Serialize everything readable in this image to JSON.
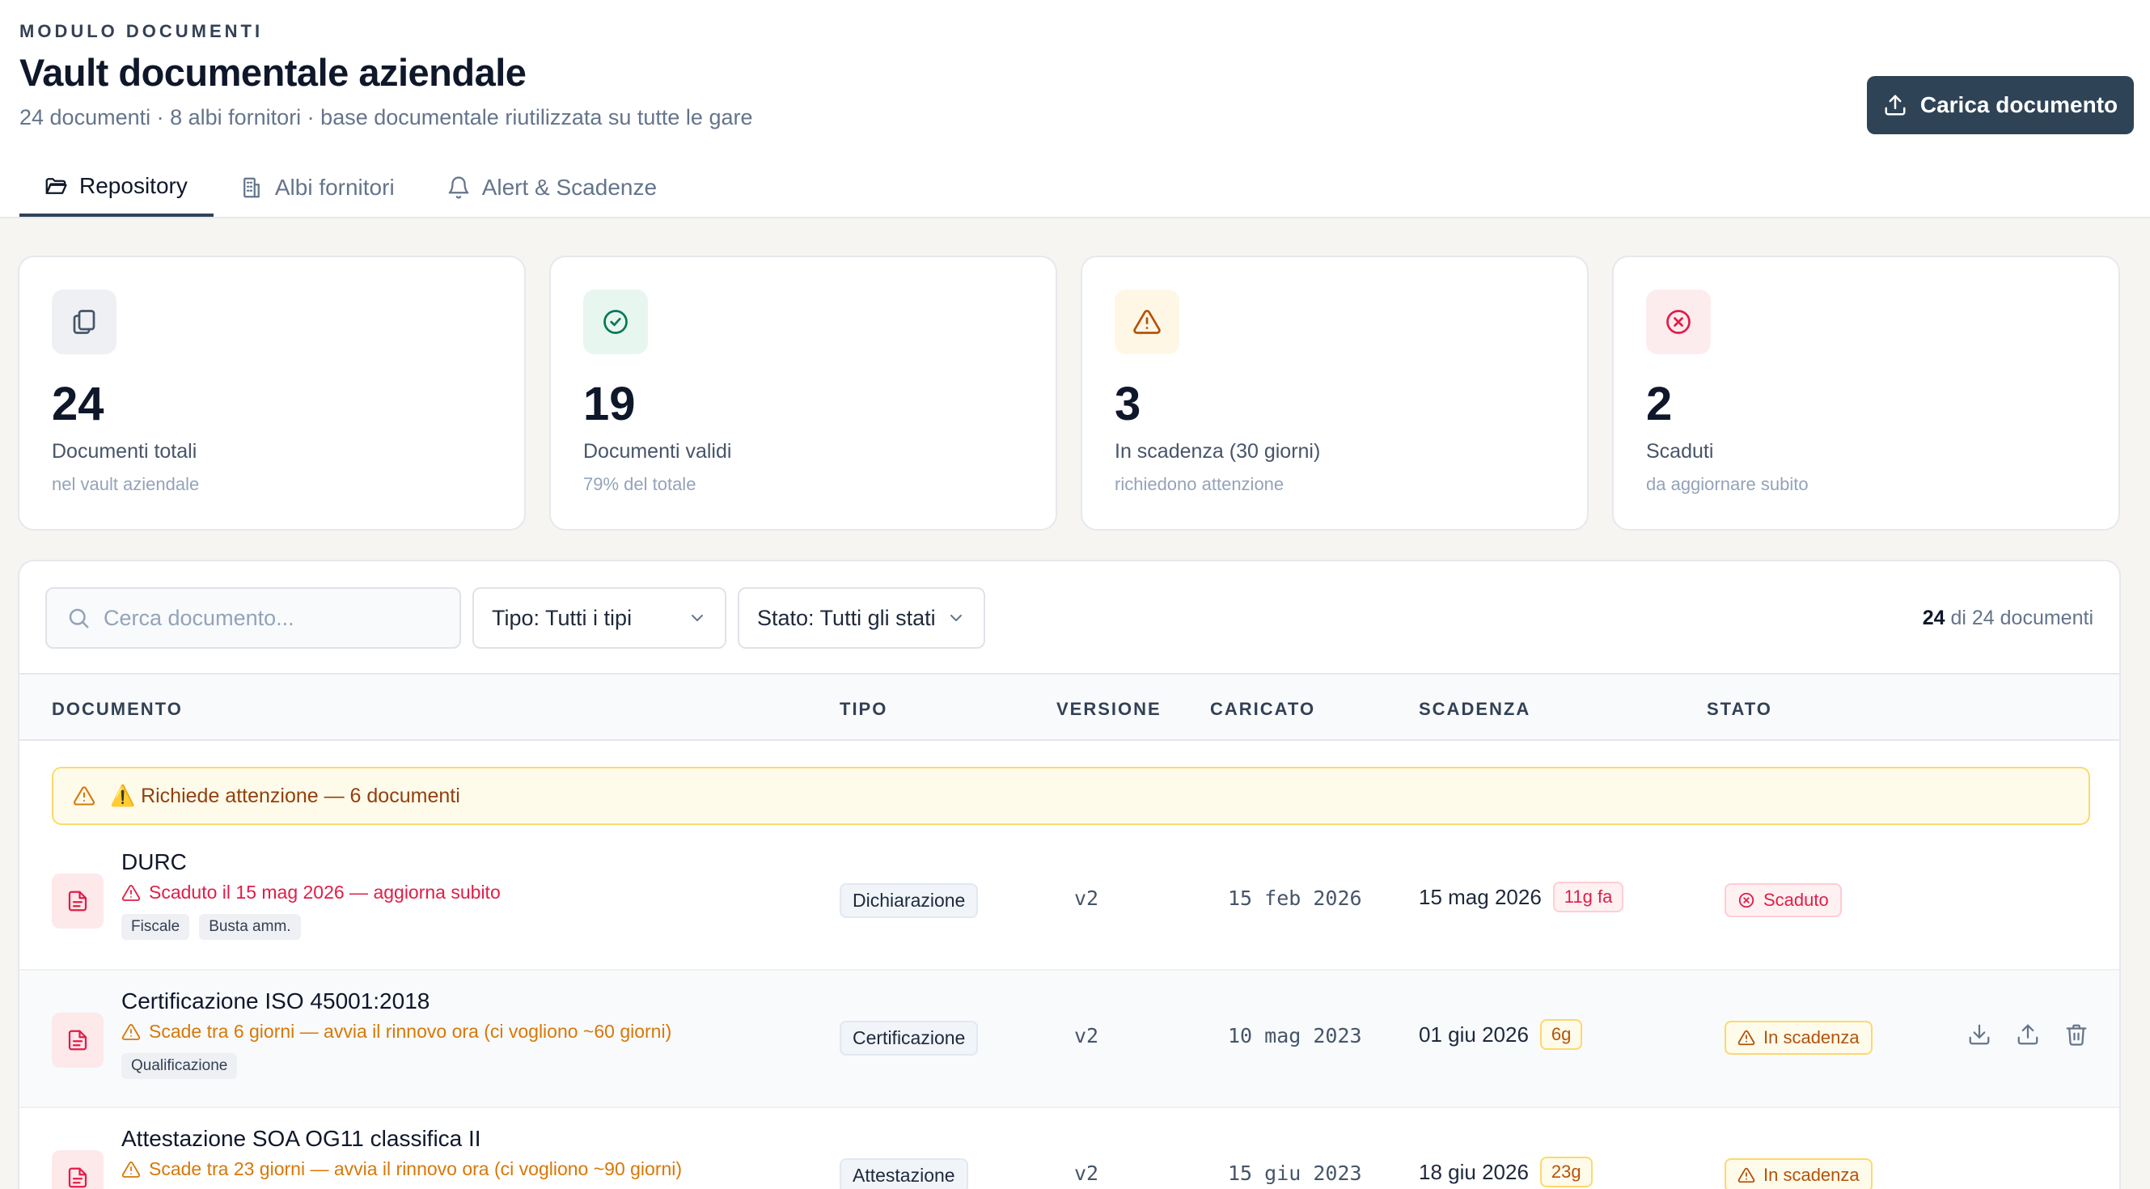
{
  "header": {
    "module_label": "MODULO DOCUMENTI",
    "title": "Vault documentale aziendale",
    "subtitle": "24 documenti · 8 albi fornitori · base documentale riutilizzata su tutte le gare",
    "upload_button": "Carica documento"
  },
  "tabs": [
    {
      "label": "Repository",
      "icon": "folder-icon",
      "active": true
    },
    {
      "label": "Albi fornitori",
      "icon": "building-icon",
      "active": false
    },
    {
      "label": "Alert & Scadenze",
      "icon": "bell-icon",
      "active": false
    }
  ],
  "stats": [
    {
      "value": "24",
      "label": "Documenti totali",
      "sub": "nel vault aziendale",
      "icon": "copy-icon",
      "color": "#475569",
      "bg": "#eef0f3"
    },
    {
      "value": "19",
      "label": "Documenti validi",
      "sub": "79% del totale",
      "icon": "check-circle-icon",
      "color": "#047857",
      "bg": "#e7f7ef"
    },
    {
      "value": "3",
      "label": "In scadenza (30 giorni)",
      "sub": "richiedono attenzione",
      "icon": "warning-icon",
      "color": "#b45309",
      "bg": "#fff7e6"
    },
    {
      "value": "2",
      "label": "Scaduti",
      "sub": "da aggiornare subito",
      "icon": "x-circle-icon",
      "color": "#e11d48",
      "bg": "#fdecee"
    }
  ],
  "filters": {
    "search_placeholder": "Cerca documento...",
    "type_select": "Tipo: Tutti i tipi",
    "status_select": "Stato: Tutti gli stati",
    "count_current": "24",
    "count_rest": " di 24 documenti"
  },
  "table": {
    "headers": [
      "DOCUMENTO",
      "TIPO",
      "VERSIONE",
      "CARICATO",
      "SCADENZA",
      "STATO"
    ],
    "alert_group": "⚠️ Richiede attenzione — 6 documenti",
    "rows": [
      {
        "name": "DURC",
        "note": "Scaduto il 15 mag 2026 — aggiorna subito",
        "tags": [
          "Fiscale",
          "Busta amm."
        ],
        "type": "Dichiarazione",
        "version": "v2",
        "uploaded": "15 feb 2026",
        "expiry": "15 mag 2026",
        "days": "11g fa",
        "status": "Scaduto"
      },
      {
        "name": "Certificazione ISO 45001:2018",
        "note": "Scade tra 6 giorni — avvia il rinnovo ora (ci vogliono ~60 giorni)",
        "tags": [
          "Qualificazione"
        ],
        "type": "Certificazione",
        "version": "v2",
        "uploaded": "10 mag 2023",
        "expiry": "01 giu 2026",
        "days": "6g",
        "status": "In scadenza"
      },
      {
        "name": "Attestazione SOA OG11 classifica II",
        "note": "Scade tra 23 giorni — avvia il rinnovo ora (ci vogliono ~90 giorni)",
        "tags": [],
        "type": "Attestazione",
        "version": "v2",
        "uploaded": "15 giu 2023",
        "expiry": "18 giu 2026",
        "days": "23g",
        "status": "In scadenza"
      }
    ]
  }
}
